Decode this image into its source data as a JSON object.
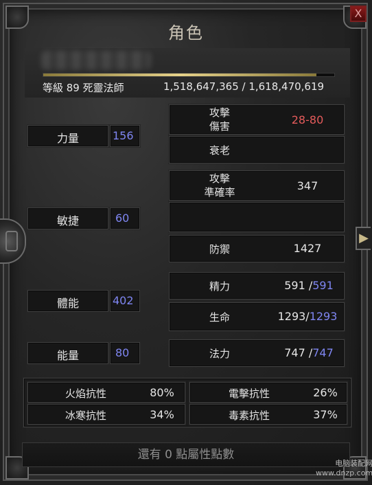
{
  "window": {
    "title": "角色",
    "close_label": "X"
  },
  "header": {
    "level_class": "等級 89 死靈法師",
    "experience": "1,518,647,365 / 1,618,470,619",
    "xp_progress": 0.938
  },
  "attributes": [
    {
      "label": "力量",
      "value": "156"
    },
    {
      "label": "敏捷",
      "value": "60"
    },
    {
      "label": "體能",
      "value": "402"
    },
    {
      "label": "能量",
      "value": "80"
    }
  ],
  "combat": {
    "attack_damage_line1": "攻擊",
    "attack_damage_line2": "傷害",
    "attack_damage_value": "28-80",
    "aging_label": "衰老",
    "attack_rating_line1": "攻擊",
    "attack_rating_line2": "準確率",
    "attack_rating_value": "347",
    "defense_label": "防禦",
    "defense_value": "1427"
  },
  "vitals": {
    "stamina_label": "精力",
    "stamina_current": "591",
    "stamina_sep": "/",
    "stamina_max": "591",
    "life_label": "生命",
    "life_current": "1293",
    "life_sep": "/",
    "life_max": "1293",
    "mana_label": "法力",
    "mana_current": "747",
    "mana_sep": "/",
    "mana_max": "747"
  },
  "resistances": {
    "fire_label": "火焰抗性",
    "fire_value": "80%",
    "lightning_label": "電擊抗性",
    "lightning_value": "26%",
    "cold_label": "冰寒抗性",
    "cold_value": "34%",
    "poison_label": "毒素抗性",
    "poison_value": "37%"
  },
  "footer": {
    "points_text": "還有 0 點屬性點數"
  },
  "watermark": {
    "line1": "电脑装配网",
    "line2": "www.dnzp.com"
  }
}
